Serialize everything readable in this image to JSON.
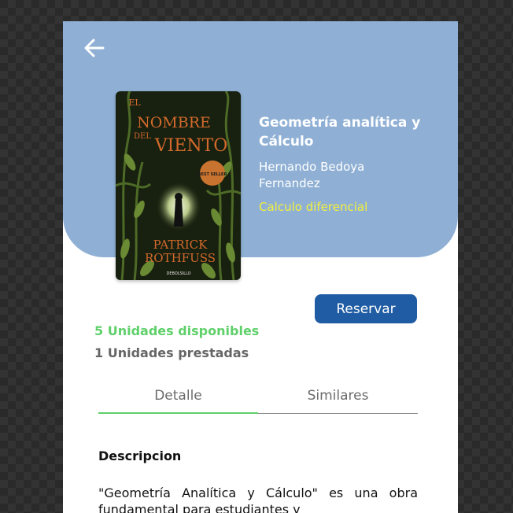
{
  "book": {
    "title": "Geometría analítica y Cálculo",
    "author": "Hernando Bedoya Fernandez",
    "category": "Calculo diferencial",
    "cover": {
      "title_line1": "EL",
      "title_line2": "NOMBRE",
      "title_line3": "DEL",
      "title_line4": "VIENTO",
      "author_line1": "PATRICK",
      "author_line2": "ROTHFUSS",
      "badge_text": "BEST SELLER",
      "publisher": "DEBOLSILLO"
    }
  },
  "actions": {
    "reserve_label": "Reservar"
  },
  "stock": {
    "available": "5 Unidades disponibles",
    "lent": "1 Unidades prestadas"
  },
  "tabs": [
    {
      "label": "Detalle",
      "active": true
    },
    {
      "label": "Similares",
      "active": false
    }
  ],
  "description": {
    "heading": "Descripcion",
    "text": "\"Geometría Analítica y Cálculo\" es una obra fundamental para estudiantes y"
  },
  "colors": {
    "header": "#8fb0d4",
    "accent_green": "#5fd06a",
    "category_yellow": "#f2ef3c",
    "button_blue": "#1f5ca4"
  },
  "icons": {
    "back": "arrow-left-icon"
  }
}
